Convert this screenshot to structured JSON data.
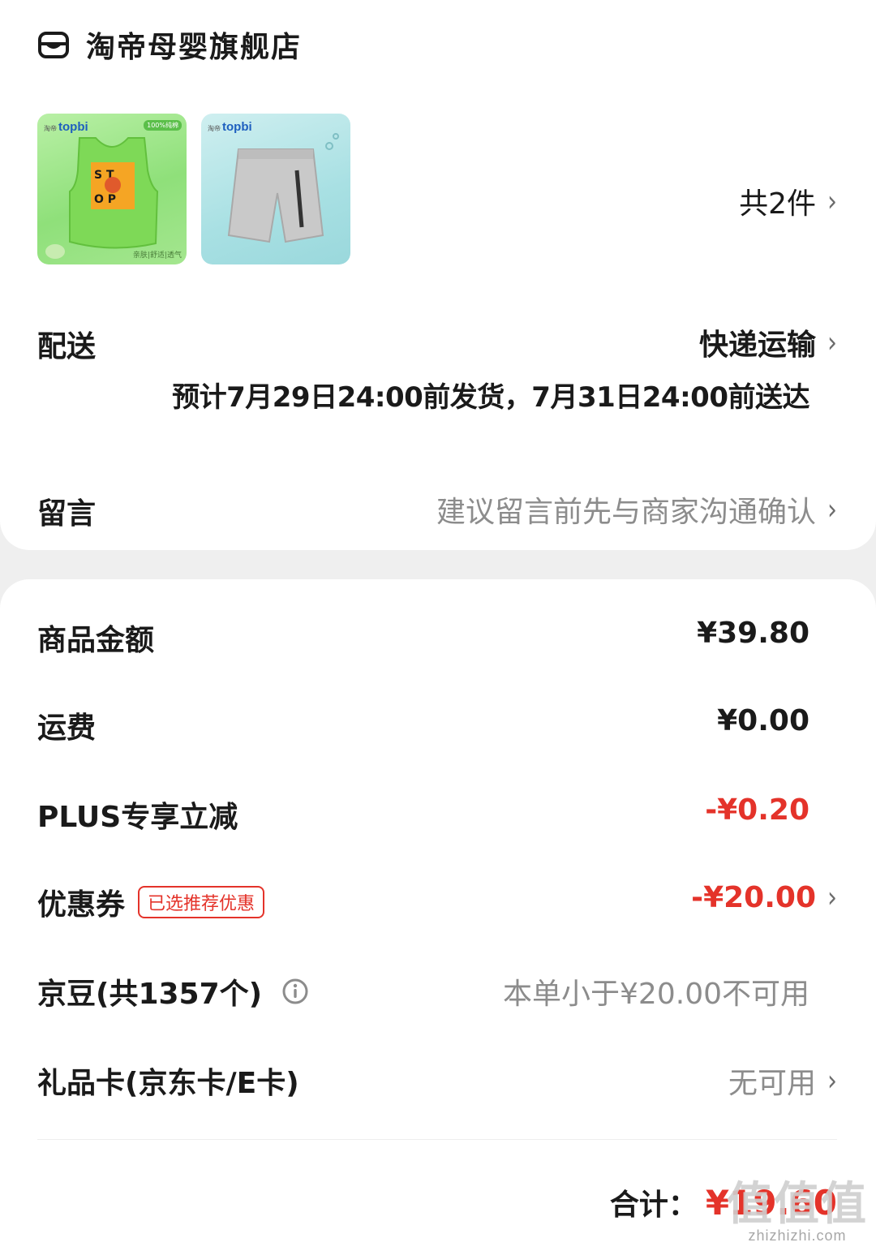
{
  "store": {
    "name": "淘帝母婴旗舰店",
    "icon": "store-icon"
  },
  "products": {
    "thumb1": {
      "brand_small": "淘帝",
      "brand": "topbi",
      "badge": "100%纯棉",
      "tagline": "亲肤|舒适|透气"
    },
    "thumb2": {
      "brand_small": "淘帝",
      "brand": "topbi"
    },
    "count_label": "共2件"
  },
  "delivery": {
    "label": "配送",
    "method": "快递运输",
    "estimate": "预计7月29日24:00前发货，7月31日24:00前送达"
  },
  "message": {
    "label": "留言",
    "placeholder": "建议留言前先与商家沟通确认"
  },
  "summary": {
    "goods_amount_label": "商品金额",
    "goods_amount": "¥39.80",
    "shipping_label": "运费",
    "shipping": "¥0.00",
    "plus_label": "PLUS专享立减",
    "plus_discount": "-¥0.20",
    "coupon_label": "优惠券",
    "coupon_tag": "已选推荐优惠",
    "coupon_discount": "-¥20.00",
    "beans_label": "京豆(共1357个)",
    "beans_value": "本单小于¥20.00不可用",
    "giftcard_label": "礼品卡(京东卡/E卡)",
    "giftcard_value": "无可用"
  },
  "total": {
    "label": "合计：",
    "amount": "¥19.60"
  },
  "watermark": {
    "glyphs": "值值值",
    "domain": "zhizhizhi.com"
  },
  "colors": {
    "accent_red": "#e4332a",
    "muted": "#8c8c8c"
  }
}
